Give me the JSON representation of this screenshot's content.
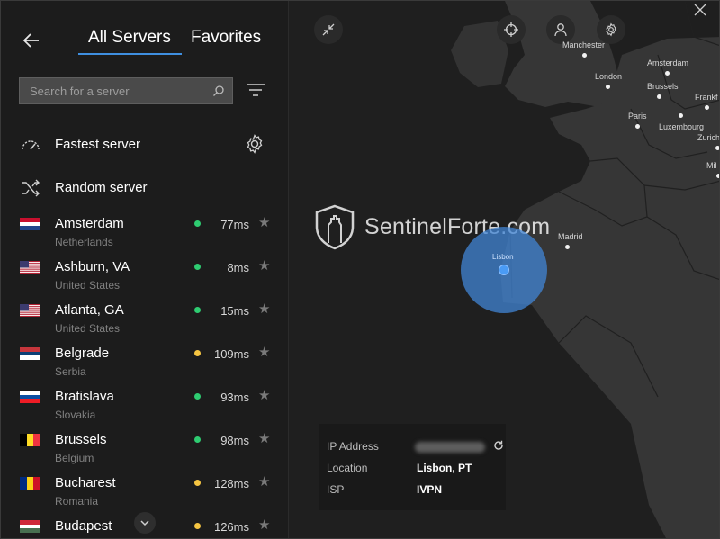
{
  "tabs": {
    "all": "All Servers",
    "favorites": "Favorites"
  },
  "search": {
    "placeholder": "Search for a server"
  },
  "menu": {
    "fastest": "Fastest server",
    "random": "Random server"
  },
  "servers": [
    {
      "city": "Amsterdam",
      "country": "Netherlands",
      "ping": "77ms",
      "status": "good"
    },
    {
      "city": "Ashburn, VA",
      "country": "United States",
      "ping": "8ms",
      "status": "good"
    },
    {
      "city": "Atlanta, GA",
      "country": "United States",
      "ping": "15ms",
      "status": "good"
    },
    {
      "city": "Belgrade",
      "country": "Serbia",
      "ping": "109ms",
      "status": "medium"
    },
    {
      "city": "Bratislava",
      "country": "Slovakia",
      "ping": "93ms",
      "status": "good"
    },
    {
      "city": "Brussels",
      "country": "Belgium",
      "ping": "98ms",
      "status": "good"
    },
    {
      "city": "Bucharest",
      "country": "Romania",
      "ping": "128ms",
      "status": "medium"
    },
    {
      "city": "Budapest",
      "country": "",
      "ping": "126ms",
      "status": "medium"
    }
  ],
  "status_colors": {
    "good": "#2ecc71",
    "medium": "#f5c542"
  },
  "accent_color": "#3f8fe0",
  "map": {
    "cities": [
      "Manchester",
      "London",
      "Amsterdam",
      "Brussels",
      "Frankf",
      "Paris",
      "Luxembourg",
      "Zurich",
      "Mil",
      "Madrid"
    ],
    "connected_city": "Lisbon",
    "watermark": "SentinelForte.com"
  },
  "info": {
    "ip_label": "IP Address",
    "location_label": "Location",
    "location_value": "Lisbon, PT",
    "isp_label": "ISP",
    "isp_value": "IVPN"
  },
  "icons": [
    "back-arrow-icon",
    "search-icon",
    "filter-icon",
    "speedometer-icon",
    "gear-icon",
    "shuffle-icon",
    "star-icon",
    "chevron-down-icon",
    "collapse-icon",
    "crosshair-icon",
    "user-icon",
    "close-icon",
    "refresh-icon",
    "shield-logo-icon"
  ]
}
